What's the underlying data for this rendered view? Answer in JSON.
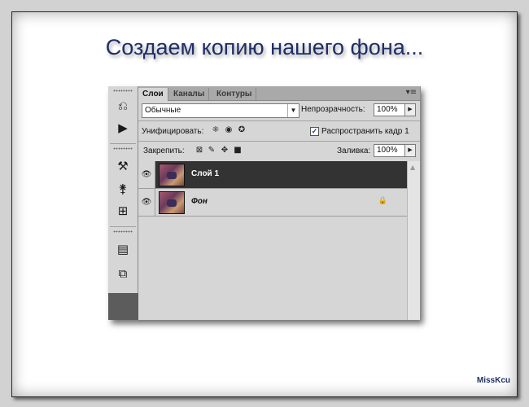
{
  "slide": {
    "title": "Создаем копию нашего фона...",
    "watermark": "MissKcu"
  },
  "dock": {
    "icons": [
      "history-icon",
      "actions-play-icon",
      "tool-presets-icon",
      "brushes-icon",
      "clone-source-icon",
      "info-icon",
      "layer-comps-icon"
    ]
  },
  "panel": {
    "tabs": [
      {
        "label": "Слои",
        "active": true
      },
      {
        "label": "Каналы",
        "active": false
      },
      {
        "label": "Контуры",
        "active": false
      }
    ],
    "menu_icon": "▾≡",
    "blend_mode": "Обычные",
    "opacity_label": "Непрозрачность:",
    "opacity_value": "100%",
    "unify_label": "Унифицировать:",
    "propagate_label": "Распространить кадр 1",
    "propagate_checked": true,
    "lock_label": "Закрепить:",
    "fill_label": "Заливка:",
    "fill_value": "100%",
    "layers": [
      {
        "name": "Слой 1",
        "selected": true,
        "visible": true,
        "locked": false
      },
      {
        "name": "Фон",
        "selected": false,
        "visible": true,
        "locked": true
      }
    ]
  },
  "colors": {
    "title": "#1f2f66",
    "selected_row": "#333333",
    "panel_bg": "#d6d6d6"
  }
}
